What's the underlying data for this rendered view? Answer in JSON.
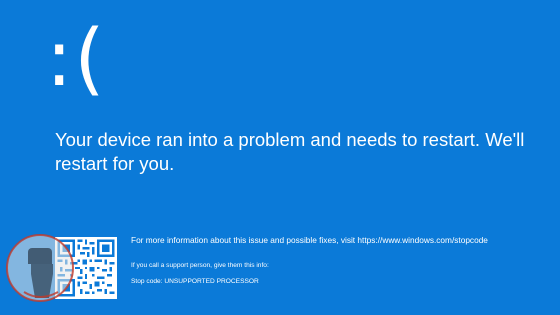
{
  "screen": {
    "background_color": "#0b7ad8",
    "sad_face": ":(",
    "message": "Your device ran into a problem and needs to restart. We'll restart for you.",
    "more_info": "For more information about this issue and possible fixes, visit https://www.windows.com/stopcode",
    "support_hint": "If you call a support person, give them this info:",
    "stop_code": "Stop code: UNSUPPORTED PROCESSOR"
  },
  "qr": {
    "icon": "qr-code-icon"
  },
  "watermark": {
    "icon": "fist-logo-watermark-icon",
    "colors": [
      "#c0392b",
      "#e6e6e6",
      "#2c3e50"
    ]
  }
}
